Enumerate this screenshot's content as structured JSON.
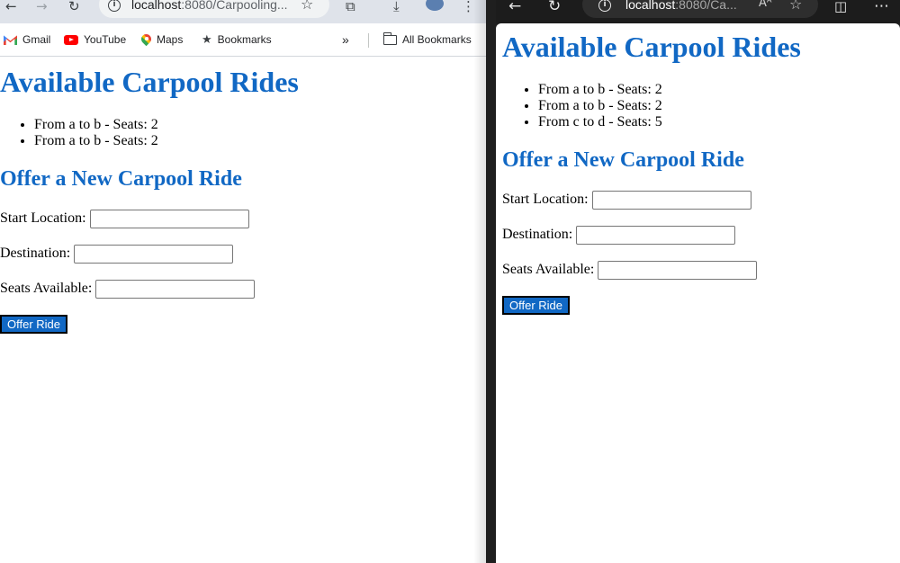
{
  "left_window": {
    "url_host": "localhost",
    "url_path": ":8080/Carpooling...",
    "bookmarks": [
      {
        "label": "Gmail",
        "icon": "gmail-icon"
      },
      {
        "label": "YouTube",
        "icon": "youtube-icon"
      },
      {
        "label": "Maps",
        "icon": "maps-icon"
      },
      {
        "label": "Bookmarks",
        "icon": "star-icon"
      }
    ],
    "overflow_label": "»",
    "all_bookmarks_label": "All Bookmarks",
    "page": {
      "title": "Available Carpool Rides",
      "rides": [
        "From a to b - Seats: 2",
        "From a to b - Seats: 2"
      ],
      "form_title": "Offer a New Carpool Ride",
      "start_label": "Start Location:",
      "start_value": "",
      "destination_label": "Destination:",
      "destination_value": "",
      "seats_label": "Seats Available:",
      "seats_value": "",
      "submit_label": "Offer Ride"
    }
  },
  "right_window": {
    "url_host": "localhost",
    "url_path": ":8080/Ca...",
    "reader_label": "Aᴬ",
    "page": {
      "title": "Available Carpool Rides",
      "rides": [
        "From a to b - Seats: 2",
        "From a to b - Seats: 2",
        "From c to d - Seats: 5"
      ],
      "form_title": "Offer a New Carpool Ride",
      "start_label": "Start Location:",
      "start_value": "",
      "destination_label": "Destination:",
      "destination_value": "",
      "seats_label": "Seats Available:",
      "seats_value": "",
      "submit_label": "Offer Ride"
    }
  },
  "colors": {
    "heading": "#1168c4",
    "button_bg": "#1168c4",
    "button_text": "#ffffff",
    "edge_chrome": "#1c1c1c",
    "chrome_toolbar": "#dfe3ea"
  }
}
